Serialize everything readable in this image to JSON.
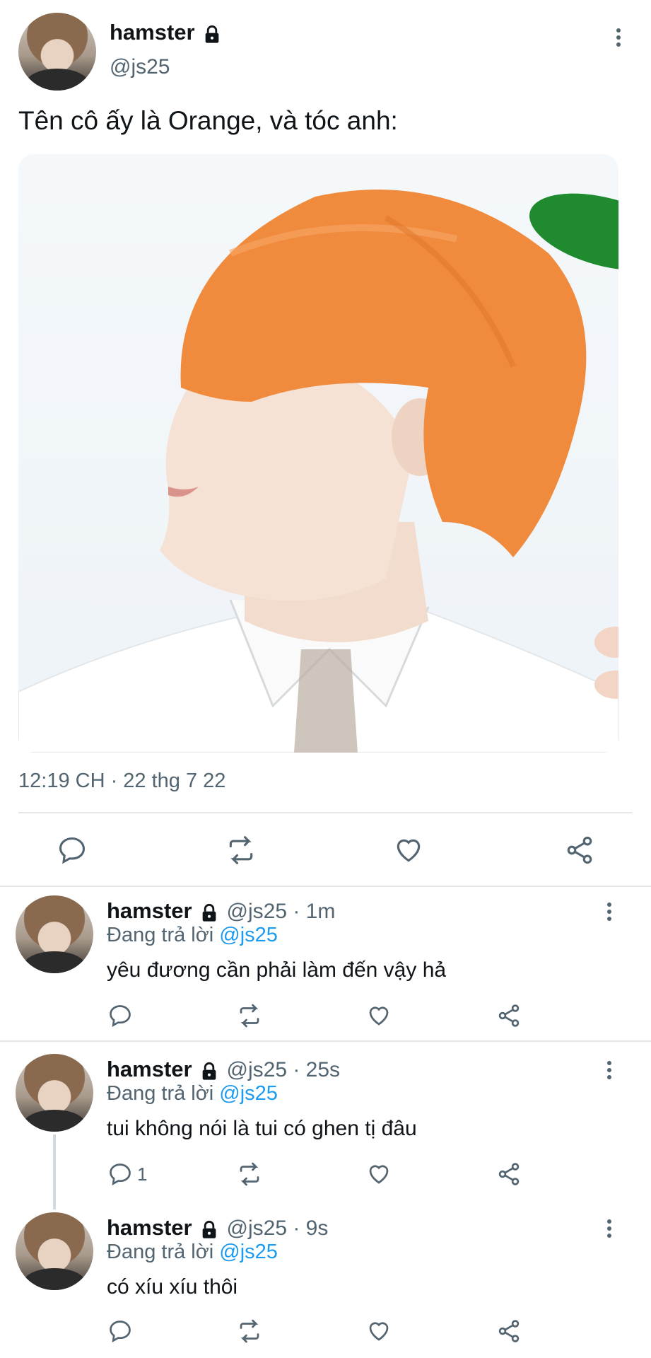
{
  "main_tweet": {
    "name": "hamster",
    "handle": "@js25",
    "text": "Tên cô ấy là Orange, và tóc anh:",
    "timestamp": "12:19 CH · 22 thg 7 22"
  },
  "replies": [
    {
      "name": "hamster",
      "handle": "@js25 · 1m",
      "replying_prefix": "Đang trả lời",
      "replying_to": "@js25",
      "text": "yêu đương cần phải làm đến vậy hả",
      "reply_count": ""
    },
    {
      "name": "hamster",
      "handle": "@js25 · 25s",
      "replying_prefix": "Đang trả lời",
      "replying_to": "@js25",
      "text": "tui không nói là tui có ghen tị đâu",
      "reply_count": "1"
    },
    {
      "name": "hamster",
      "handle": "@js25 · 9s",
      "replying_prefix": "Đang trả lời",
      "replying_to": "@js25",
      "text": "có xíu xíu thôi",
      "reply_count": ""
    }
  ],
  "colors": {
    "accent": "#1d9bf0",
    "secondary_text": "#536471",
    "hair_orange": "#f08a3c"
  },
  "icons": [
    "lock-icon",
    "more-icon",
    "reply-icon",
    "retweet-icon",
    "like-icon",
    "share-icon"
  ]
}
